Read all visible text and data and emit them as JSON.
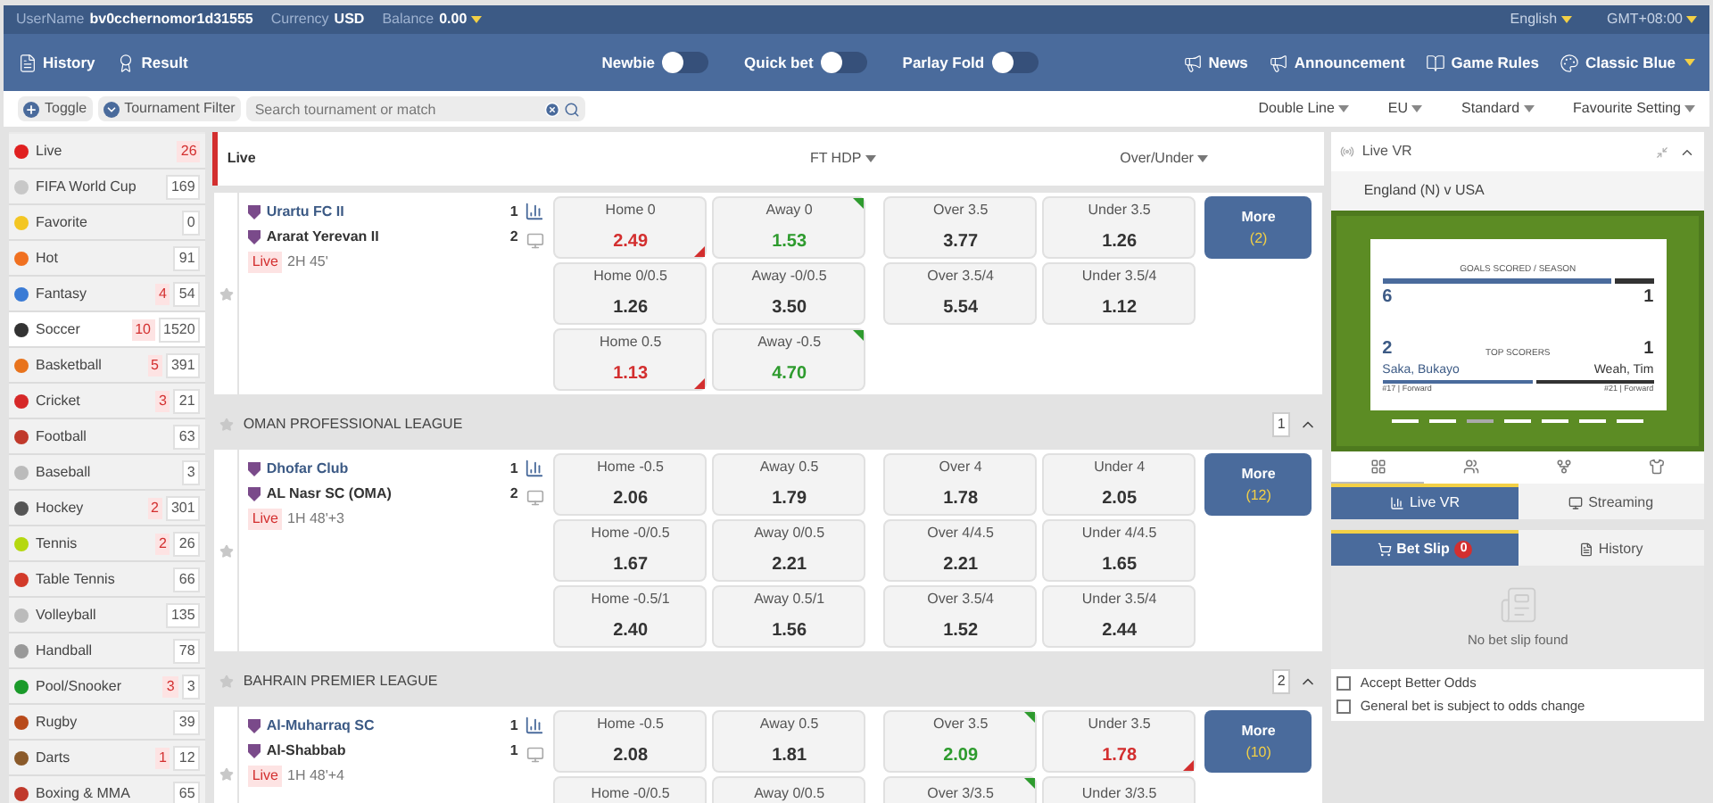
{
  "account": {
    "username_label": "UserName",
    "username": "bv0cchernomor1d31555",
    "currency_label": "Currency",
    "currency": "USD",
    "balance_label": "Balance",
    "balance": "0.00",
    "language": "English",
    "timezone": "GMT+08:00"
  },
  "toolbar": {
    "left": [
      {
        "kind": "history",
        "label": "History"
      },
      {
        "kind": "result",
        "label": "Result"
      }
    ],
    "toggles": [
      {
        "label": "Newbie",
        "on": false
      },
      {
        "label": "Quick bet",
        "on": false
      },
      {
        "label": "Parlay Fold",
        "on": false
      }
    ],
    "right": [
      {
        "kind": "news",
        "label": "News"
      },
      {
        "kind": "announcement",
        "label": "Announcement"
      },
      {
        "kind": "rules",
        "label": "Game Rules"
      },
      {
        "kind": "theme",
        "label": "Classic Blue"
      }
    ]
  },
  "filter_bar": {
    "buttons": [
      {
        "kind": "toggle",
        "label": "Toggle"
      },
      {
        "kind": "filter",
        "label": "Tournament Filter"
      }
    ],
    "search": {
      "placeholder": "Search tournament or match"
    },
    "dropdowns": [
      "Double Line",
      "EU",
      "Standard",
      "Favourite Setting"
    ]
  },
  "sports": [
    {
      "name": "Live",
      "live": "26",
      "color": "#e02020",
      "selected": false
    },
    {
      "name": "FIFA World Cup",
      "total": "169",
      "color": "#c8c8c8",
      "selected": false
    },
    {
      "name": "Favorite",
      "total": "0",
      "color": "#f3c623",
      "selected": false
    },
    {
      "name": "Hot",
      "total": "91",
      "color": "#f07020",
      "selected": false
    },
    {
      "name": "Fantasy",
      "live": "4",
      "total": "54",
      "color": "#3a7bd5",
      "selected": false
    },
    {
      "name": "Soccer",
      "live": "10",
      "total": "1520",
      "color": "#333333",
      "selected": true
    },
    {
      "name": "Basketball",
      "live": "5",
      "total": "391",
      "color": "#e8731c",
      "selected": false
    },
    {
      "name": "Cricket",
      "live": "3",
      "total": "21",
      "color": "#d62828",
      "selected": false
    },
    {
      "name": "Football",
      "total": "63",
      "color": "#c0392b",
      "selected": false
    },
    {
      "name": "Baseball",
      "total": "3",
      "color": "#bbbbbb",
      "selected": false
    },
    {
      "name": "Hockey",
      "live": "2",
      "total": "301",
      "color": "#555555",
      "selected": false
    },
    {
      "name": "Tennis",
      "live": "2",
      "total": "26",
      "color": "#b5d80f",
      "selected": false
    },
    {
      "name": "Table Tennis",
      "total": "66",
      "color": "#d23a2a",
      "selected": false
    },
    {
      "name": "Volleyball",
      "total": "135",
      "color": "#bbbbbb",
      "selected": false
    },
    {
      "name": "Handball",
      "total": "78",
      "color": "#999999",
      "selected": false
    },
    {
      "name": "Pool/Snooker",
      "live": "3",
      "total": "3",
      "color": "#1a9a2a",
      "selected": false
    },
    {
      "name": "Rugby",
      "total": "39",
      "color": "#b84a1a",
      "selected": false
    },
    {
      "name": "Darts",
      "live": "1",
      "total": "12",
      "color": "#8a5a2a",
      "selected": false
    },
    {
      "name": "Boxing & MMA",
      "total": "65",
      "color": "#c0392b",
      "selected": false
    }
  ],
  "markets": {
    "title": "Live",
    "columns": [
      "FT HDP",
      "Over/Under"
    ],
    "leagues": [
      {
        "matches": [
          {
            "home": "Urartu FC II",
            "away": "Ararat Yerevan II",
            "home_score": "1",
            "away_score": "2",
            "status": "Live",
            "time": "2H 45'",
            "more": "More",
            "more_count": "(2)",
            "rows": [
              [
                {
                  "label": "Home 0",
                  "odds": "2.49",
                  "up": false,
                  "down": true
                },
                {
                  "label": "Away 0",
                  "odds": "1.53",
                  "up": true,
                  "down": false
                },
                {
                  "label": "Over 3.5",
                  "odds": "3.77",
                  "up": false,
                  "down": false
                },
                {
                  "label": "Under 3.5",
                  "odds": "1.26",
                  "up": false,
                  "down": false
                }
              ],
              [
                {
                  "label": "Home 0/0.5",
                  "odds": "1.26",
                  "up": false,
                  "down": false
                },
                {
                  "label": "Away -0/0.5",
                  "odds": "3.50",
                  "up": false,
                  "down": false
                },
                {
                  "label": "Over 3.5/4",
                  "odds": "5.54",
                  "up": false,
                  "down": false
                },
                {
                  "label": "Under 3.5/4",
                  "odds": "1.12",
                  "up": false,
                  "down": false
                }
              ],
              [
                {
                  "label": "Home 0.5",
                  "odds": "1.13",
                  "up": false,
                  "down": true
                },
                {
                  "label": "Away -0.5",
                  "odds": "4.70",
                  "up": true,
                  "down": false
                },
                null,
                null
              ]
            ]
          }
        ]
      },
      {
        "name": "OMAN PROFESSIONAL LEAGUE",
        "count": "1",
        "expanded": true,
        "matches": [
          {
            "home": "Dhofar Club",
            "away": "AL Nasr SC (OMA)",
            "home_score": "1",
            "away_score": "2",
            "status": "Live",
            "time": "1H 48'+3",
            "more": "More",
            "more_count": "(12)",
            "rows": [
              [
                {
                  "label": "Home -0.5",
                  "odds": "2.06",
                  "up": false,
                  "down": false
                },
                {
                  "label": "Away 0.5",
                  "odds": "1.79",
                  "up": false,
                  "down": false
                },
                {
                  "label": "Over 4",
                  "odds": "1.78",
                  "up": false,
                  "down": false
                },
                {
                  "label": "Under 4",
                  "odds": "2.05",
                  "up": false,
                  "down": false
                }
              ],
              [
                {
                  "label": "Home -0/0.5",
                  "odds": "1.67",
                  "up": false,
                  "down": false
                },
                {
                  "label": "Away 0/0.5",
                  "odds": "2.21",
                  "up": false,
                  "down": false
                },
                {
                  "label": "Over 4/4.5",
                  "odds": "2.21",
                  "up": false,
                  "down": false
                },
                {
                  "label": "Under 4/4.5",
                  "odds": "1.65",
                  "up": false,
                  "down": false
                }
              ],
              [
                {
                  "label": "Home -0.5/1",
                  "odds": "2.40",
                  "up": false,
                  "down": false
                },
                {
                  "label": "Away 0.5/1",
                  "odds": "1.56",
                  "up": false,
                  "down": false
                },
                {
                  "label": "Over 3.5/4",
                  "odds": "1.52",
                  "up": false,
                  "down": false
                },
                {
                  "label": "Under 3.5/4",
                  "odds": "2.44",
                  "up": false,
                  "down": false
                }
              ]
            ]
          }
        ]
      },
      {
        "name": "BAHRAIN PREMIER LEAGUE",
        "count": "2",
        "expanded": true,
        "matches": [
          {
            "home": "Al-Muharraq SC",
            "away": "Al-Shabbab",
            "home_score": "1",
            "away_score": "1",
            "status": "Live",
            "time": "1H 48'+4",
            "more": "More",
            "more_count": "(10)",
            "rows": [
              [
                {
                  "label": "Home -0.5",
                  "odds": "2.08",
                  "up": false,
                  "down": false
                },
                {
                  "label": "Away 0.5",
                  "odds": "1.81",
                  "up": false,
                  "down": false
                },
                {
                  "label": "Over 3.5",
                  "odds": "2.09",
                  "up": true,
                  "down": false
                },
                {
                  "label": "Under 3.5",
                  "odds": "1.78",
                  "up": false,
                  "down": true
                }
              ],
              [
                {
                  "label": "Home -0/0.5",
                  "up": false
                },
                {
                  "label": "Away 0/0.5",
                  "up": false
                },
                {
                  "label": "Over 3/3.5",
                  "up": true
                },
                {
                  "label": "Under 3/3.5",
                  "up": false
                }
              ]
            ]
          }
        ]
      }
    ]
  },
  "live_vr": {
    "title": "Live VR",
    "match": "England (N) v USA",
    "stats": {
      "goals_title": "GOALS SCORED / SEASON",
      "home_goals": "6",
      "away_goals": "1",
      "goals_bar": {
        "level": 0.86
      },
      "scorers_title": "TOP SCORERS",
      "home_scorer_goals": "2",
      "away_scorer_goals": "1",
      "home_scorer": "Saka, Bukayo",
      "away_scorer": "Weah, Tim",
      "home_scorer_info": "#17 | Forward",
      "away_scorer_info": "#21 | Forward",
      "scorers_bar": {
        "level": 0.57
      }
    },
    "pager": [
      {
        "selected": false
      },
      {
        "selected": false
      },
      {
        "selected": true
      },
      {
        "selected": false
      },
      {
        "selected": false
      },
      {
        "selected": false
      },
      {
        "selected": false
      }
    ],
    "icon_tabs": [
      {
        "kind": "scoreboard",
        "selected": true
      },
      {
        "kind": "lineup",
        "selected": false
      },
      {
        "kind": "bracket",
        "selected": false
      },
      {
        "kind": "shirt",
        "selected": false
      }
    ],
    "view_tabs": [
      {
        "kind": "chart",
        "label": "Live VR",
        "selected": true
      },
      {
        "kind": "stream",
        "label": "Streaming",
        "selected": false
      }
    ]
  },
  "bet_slip": {
    "tabs": [
      {
        "kind": "slip",
        "label": "Bet Slip",
        "badge": "0",
        "selected": true
      },
      {
        "kind": "history",
        "label": "History",
        "selected": false
      }
    ],
    "empty_text": "No bet slip found",
    "options": [
      {
        "label": "Accept Better Odds",
        "checked": false
      },
      {
        "label": "General bet is subject to odds change",
        "checked": false
      }
    ]
  }
}
